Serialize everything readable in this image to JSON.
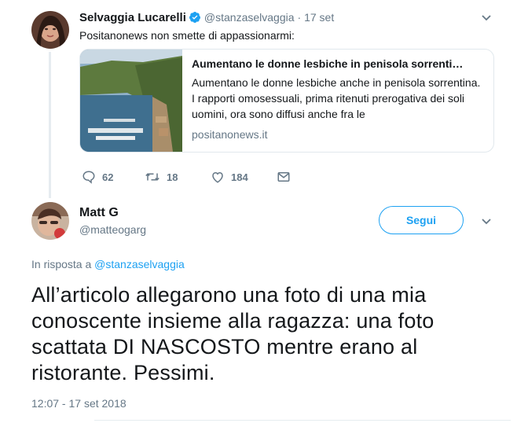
{
  "parent_tweet": {
    "author_name": "Selvaggia Lucarelli",
    "handle": "@stanzaselvaggia",
    "time": "· 17 set",
    "text": "Positanonews non smette di appassionarmi:",
    "card": {
      "title": "Aumentano le donne lesbiche in penisola sorrenti…",
      "description": "Aumentano le donne lesbiche anche in penisola sorrentina. I rapporti omosessuali, prima ritenuti prerogativa dei soli uomini, ora sono diffusi anche fra le",
      "domain": "positanonews.it"
    },
    "actions": {
      "replies": "62",
      "retweets": "18",
      "likes": "184"
    }
  },
  "reply_tweet": {
    "author_name": "Matt G",
    "handle": "@matteogarg",
    "follow_label": "Segui",
    "reply_prefix": "In risposta a",
    "reply_to_handle": "@stanzaselvaggia",
    "text": "All’articolo allegarono una foto di una mia conoscente insieme alla ragazza: una foto scattata DI NASCOSTO mentre erano al ristorante. Pessimi.",
    "timestamp": "12:07 - 17 set 2018"
  },
  "colors": {
    "accent": "#1da1f2",
    "secondary_text": "#657786",
    "border": "#e1e8ed"
  },
  "icons": [
    "verified-badge-icon",
    "chevron-down-icon",
    "reply-icon",
    "retweet-icon",
    "like-icon",
    "dm-icon"
  ]
}
